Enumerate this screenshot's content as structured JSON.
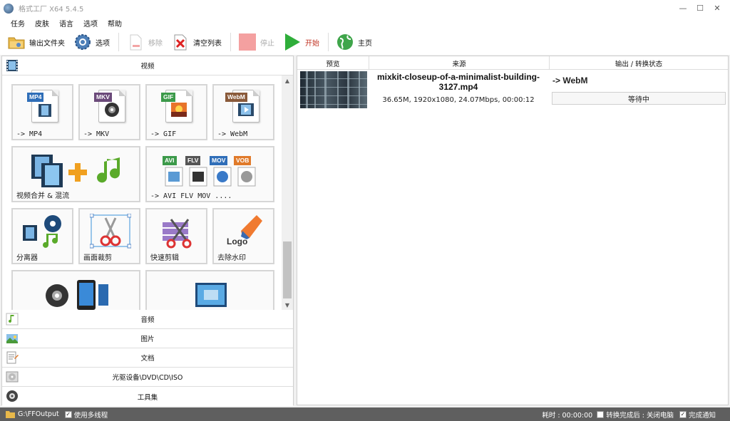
{
  "window": {
    "title": "格式工厂 X64 5.4.5",
    "minimize": "—",
    "maximize": "☐",
    "close": "✕"
  },
  "menu": [
    "任务",
    "皮肤",
    "语言",
    "选项",
    "帮助"
  ],
  "toolbar": {
    "output_folder": "输出文件夹",
    "options": "选项",
    "remove": "移除",
    "clear_list": "清空列表",
    "stop": "停止",
    "start": "开始",
    "home": "主页"
  },
  "left": {
    "video_header": "视频",
    "tiles": {
      "mp4": {
        "badge": "MP4",
        "label": "-> MP4"
      },
      "mkv": {
        "badge": "MKV",
        "label": "-> MKV"
      },
      "gif": {
        "badge": "GIF",
        "label": "-> GIF"
      },
      "webm": {
        "badge": "WebM",
        "label": "-> WebM"
      },
      "merge": {
        "label": "视频合并 & 混流"
      },
      "multi": {
        "badges": [
          "AVI",
          "FLV",
          "MOV",
          "VOB"
        ],
        "label": "-> AVI FLV MOV ...."
      },
      "splitter": {
        "label": "分离器"
      },
      "crop": {
        "label": "画面裁剪"
      },
      "quickcut": {
        "label": "快速剪辑"
      },
      "watermark": {
        "label": "去除水印",
        "logo_text": "Logo"
      }
    },
    "sections": [
      "音频",
      "图片",
      "文档",
      "光驱设备\\DVD\\CD\\ISO",
      "工具集"
    ]
  },
  "table": {
    "headers": [
      "预览",
      "来源",
      "输出 / 转换状态"
    ],
    "rows": [
      {
        "filename": "mixkit-closeup-of-a-minimalist-building-3127.mp4",
        "details": "36.65M, 1920x1080, 24.07Mbps, 00:00:12",
        "output": "-> WebM",
        "status": "等待中"
      }
    ]
  },
  "statusbar": {
    "output_path": "G:\\FFOutput",
    "multithread": "使用多线程",
    "elapsed": "耗时 : 00:00:00",
    "after_done": "转换完成后 : 关闭电脑",
    "notify": "完成通知"
  },
  "colors": {
    "accent_green": "#2fae3a",
    "stop_red": "#f08080",
    "statusbar": "#5f5f5f"
  }
}
